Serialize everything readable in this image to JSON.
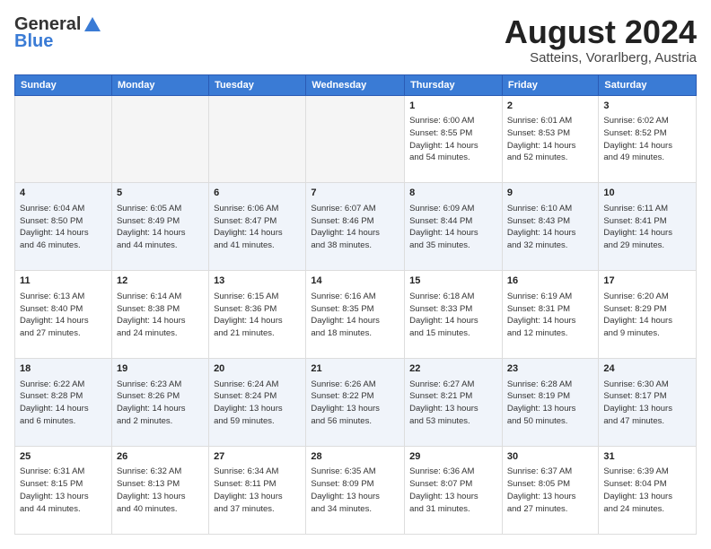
{
  "logo": {
    "general": "General",
    "blue": "Blue"
  },
  "title": "August 2024",
  "subtitle": "Satteins, Vorarlberg, Austria",
  "days_header": [
    "Sunday",
    "Monday",
    "Tuesday",
    "Wednesday",
    "Thursday",
    "Friday",
    "Saturday"
  ],
  "weeks": [
    [
      {
        "day": "",
        "info": ""
      },
      {
        "day": "",
        "info": ""
      },
      {
        "day": "",
        "info": ""
      },
      {
        "day": "",
        "info": ""
      },
      {
        "day": "1",
        "info": "Sunrise: 6:00 AM\nSunset: 8:55 PM\nDaylight: 14 hours\nand 54 minutes."
      },
      {
        "day": "2",
        "info": "Sunrise: 6:01 AM\nSunset: 8:53 PM\nDaylight: 14 hours\nand 52 minutes."
      },
      {
        "day": "3",
        "info": "Sunrise: 6:02 AM\nSunset: 8:52 PM\nDaylight: 14 hours\nand 49 minutes."
      }
    ],
    [
      {
        "day": "4",
        "info": "Sunrise: 6:04 AM\nSunset: 8:50 PM\nDaylight: 14 hours\nand 46 minutes."
      },
      {
        "day": "5",
        "info": "Sunrise: 6:05 AM\nSunset: 8:49 PM\nDaylight: 14 hours\nand 44 minutes."
      },
      {
        "day": "6",
        "info": "Sunrise: 6:06 AM\nSunset: 8:47 PM\nDaylight: 14 hours\nand 41 minutes."
      },
      {
        "day": "7",
        "info": "Sunrise: 6:07 AM\nSunset: 8:46 PM\nDaylight: 14 hours\nand 38 minutes."
      },
      {
        "day": "8",
        "info": "Sunrise: 6:09 AM\nSunset: 8:44 PM\nDaylight: 14 hours\nand 35 minutes."
      },
      {
        "day": "9",
        "info": "Sunrise: 6:10 AM\nSunset: 8:43 PM\nDaylight: 14 hours\nand 32 minutes."
      },
      {
        "day": "10",
        "info": "Sunrise: 6:11 AM\nSunset: 8:41 PM\nDaylight: 14 hours\nand 29 minutes."
      }
    ],
    [
      {
        "day": "11",
        "info": "Sunrise: 6:13 AM\nSunset: 8:40 PM\nDaylight: 14 hours\nand 27 minutes."
      },
      {
        "day": "12",
        "info": "Sunrise: 6:14 AM\nSunset: 8:38 PM\nDaylight: 14 hours\nand 24 minutes."
      },
      {
        "day": "13",
        "info": "Sunrise: 6:15 AM\nSunset: 8:36 PM\nDaylight: 14 hours\nand 21 minutes."
      },
      {
        "day": "14",
        "info": "Sunrise: 6:16 AM\nSunset: 8:35 PM\nDaylight: 14 hours\nand 18 minutes."
      },
      {
        "day": "15",
        "info": "Sunrise: 6:18 AM\nSunset: 8:33 PM\nDaylight: 14 hours\nand 15 minutes."
      },
      {
        "day": "16",
        "info": "Sunrise: 6:19 AM\nSunset: 8:31 PM\nDaylight: 14 hours\nand 12 minutes."
      },
      {
        "day": "17",
        "info": "Sunrise: 6:20 AM\nSunset: 8:29 PM\nDaylight: 14 hours\nand 9 minutes."
      }
    ],
    [
      {
        "day": "18",
        "info": "Sunrise: 6:22 AM\nSunset: 8:28 PM\nDaylight: 14 hours\nand 6 minutes."
      },
      {
        "day": "19",
        "info": "Sunrise: 6:23 AM\nSunset: 8:26 PM\nDaylight: 14 hours\nand 2 minutes."
      },
      {
        "day": "20",
        "info": "Sunrise: 6:24 AM\nSunset: 8:24 PM\nDaylight: 13 hours\nand 59 minutes."
      },
      {
        "day": "21",
        "info": "Sunrise: 6:26 AM\nSunset: 8:22 PM\nDaylight: 13 hours\nand 56 minutes."
      },
      {
        "day": "22",
        "info": "Sunrise: 6:27 AM\nSunset: 8:21 PM\nDaylight: 13 hours\nand 53 minutes."
      },
      {
        "day": "23",
        "info": "Sunrise: 6:28 AM\nSunset: 8:19 PM\nDaylight: 13 hours\nand 50 minutes."
      },
      {
        "day": "24",
        "info": "Sunrise: 6:30 AM\nSunset: 8:17 PM\nDaylight: 13 hours\nand 47 minutes."
      }
    ],
    [
      {
        "day": "25",
        "info": "Sunrise: 6:31 AM\nSunset: 8:15 PM\nDaylight: 13 hours\nand 44 minutes."
      },
      {
        "day": "26",
        "info": "Sunrise: 6:32 AM\nSunset: 8:13 PM\nDaylight: 13 hours\nand 40 minutes."
      },
      {
        "day": "27",
        "info": "Sunrise: 6:34 AM\nSunset: 8:11 PM\nDaylight: 13 hours\nand 37 minutes."
      },
      {
        "day": "28",
        "info": "Sunrise: 6:35 AM\nSunset: 8:09 PM\nDaylight: 13 hours\nand 34 minutes."
      },
      {
        "day": "29",
        "info": "Sunrise: 6:36 AM\nSunset: 8:07 PM\nDaylight: 13 hours\nand 31 minutes."
      },
      {
        "day": "30",
        "info": "Sunrise: 6:37 AM\nSunset: 8:05 PM\nDaylight: 13 hours\nand 27 minutes."
      },
      {
        "day": "31",
        "info": "Sunrise: 6:39 AM\nSunset: 8:04 PM\nDaylight: 13 hours\nand 24 minutes."
      }
    ]
  ]
}
